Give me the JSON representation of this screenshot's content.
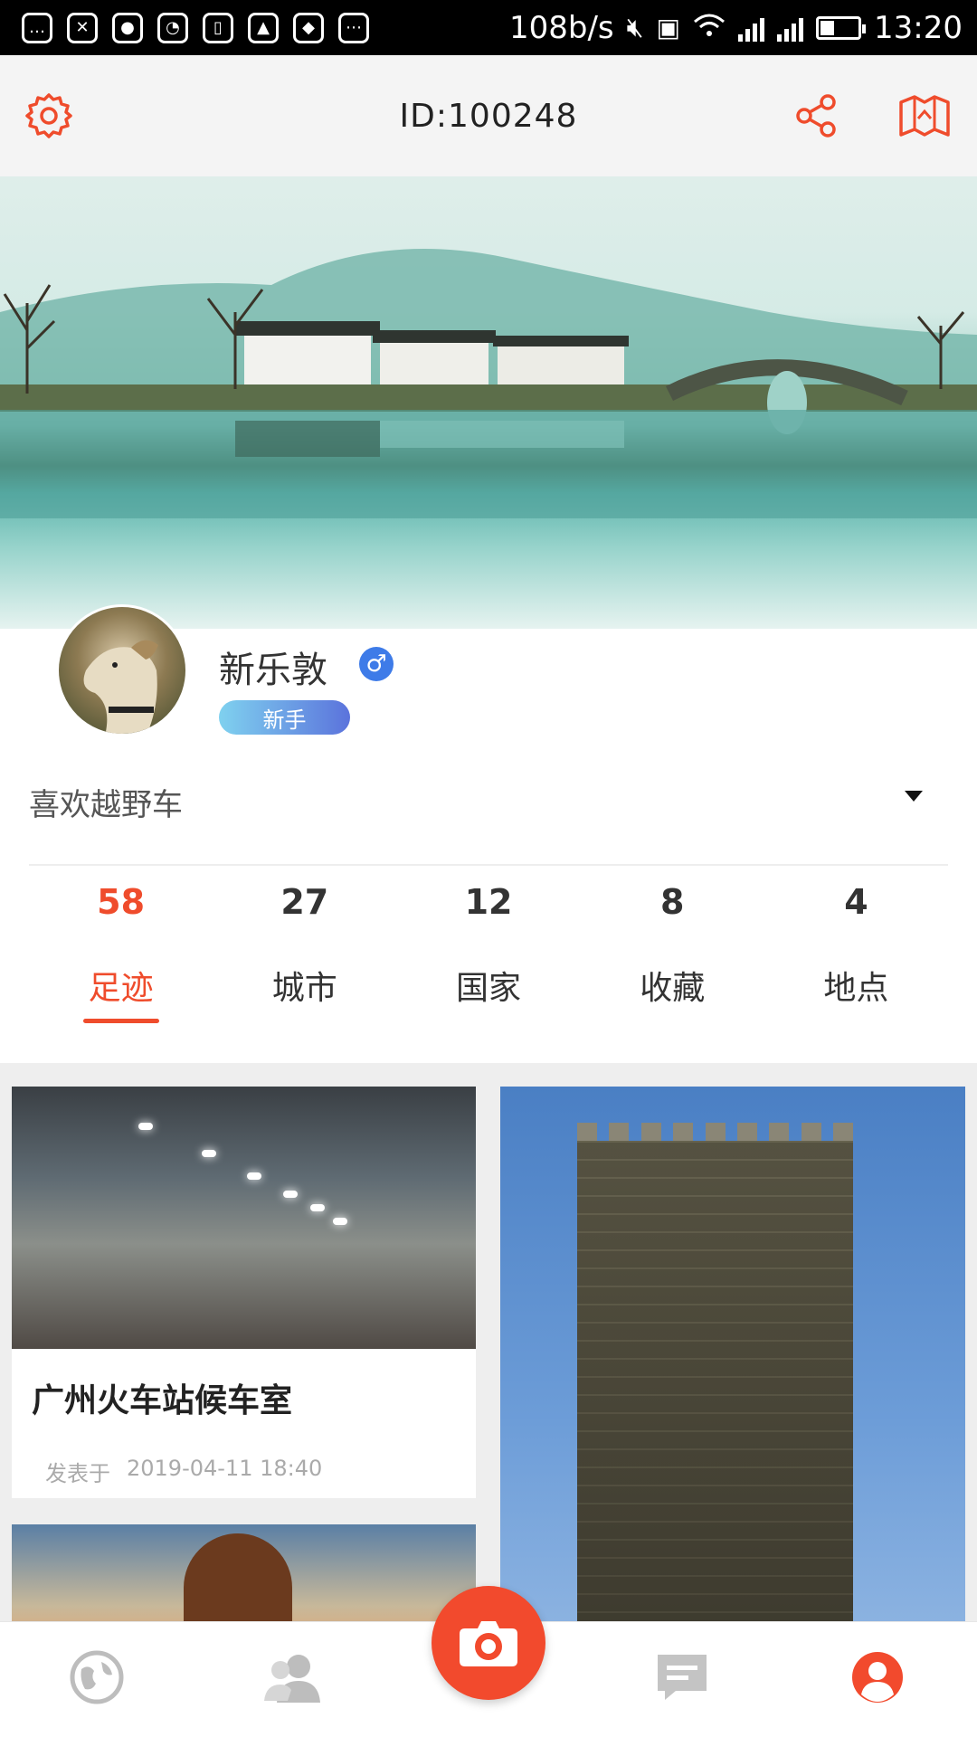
{
  "status_bar": {
    "network_speed": "108b/s",
    "time": "13:20"
  },
  "header": {
    "user_id": "ID:100248"
  },
  "profile": {
    "username": "新乐敦",
    "gender_symbol": "♂",
    "level_badge": "新手",
    "bio": "喜欢越野车"
  },
  "stats": [
    {
      "count": "58",
      "label": "足迹",
      "active": true
    },
    {
      "count": "27",
      "label": "城市",
      "active": false
    },
    {
      "count": "12",
      "label": "国家",
      "active": false
    },
    {
      "count": "8",
      "label": "收藏",
      "active": false
    },
    {
      "count": "4",
      "label": "地点",
      "active": false
    }
  ],
  "feed": {
    "cards": [
      {
        "title": "广州火车站候车室",
        "meta_prefix": "发表于",
        "meta_time": "2019-04-11 18:40"
      }
    ]
  },
  "colors": {
    "accent": "#ef4c2c",
    "badge_start": "#7fd1ef",
    "badge_end": "#5b73dc",
    "gender": "#3e7be8"
  },
  "icons": {
    "settings": "gear-icon",
    "share": "share-icon",
    "map": "map-icon",
    "nav_globe": "globe-icon",
    "nav_friends": "friends-icon",
    "nav_camera": "camera-icon",
    "nav_messages": "message-icon",
    "nav_profile": "profile-icon"
  }
}
